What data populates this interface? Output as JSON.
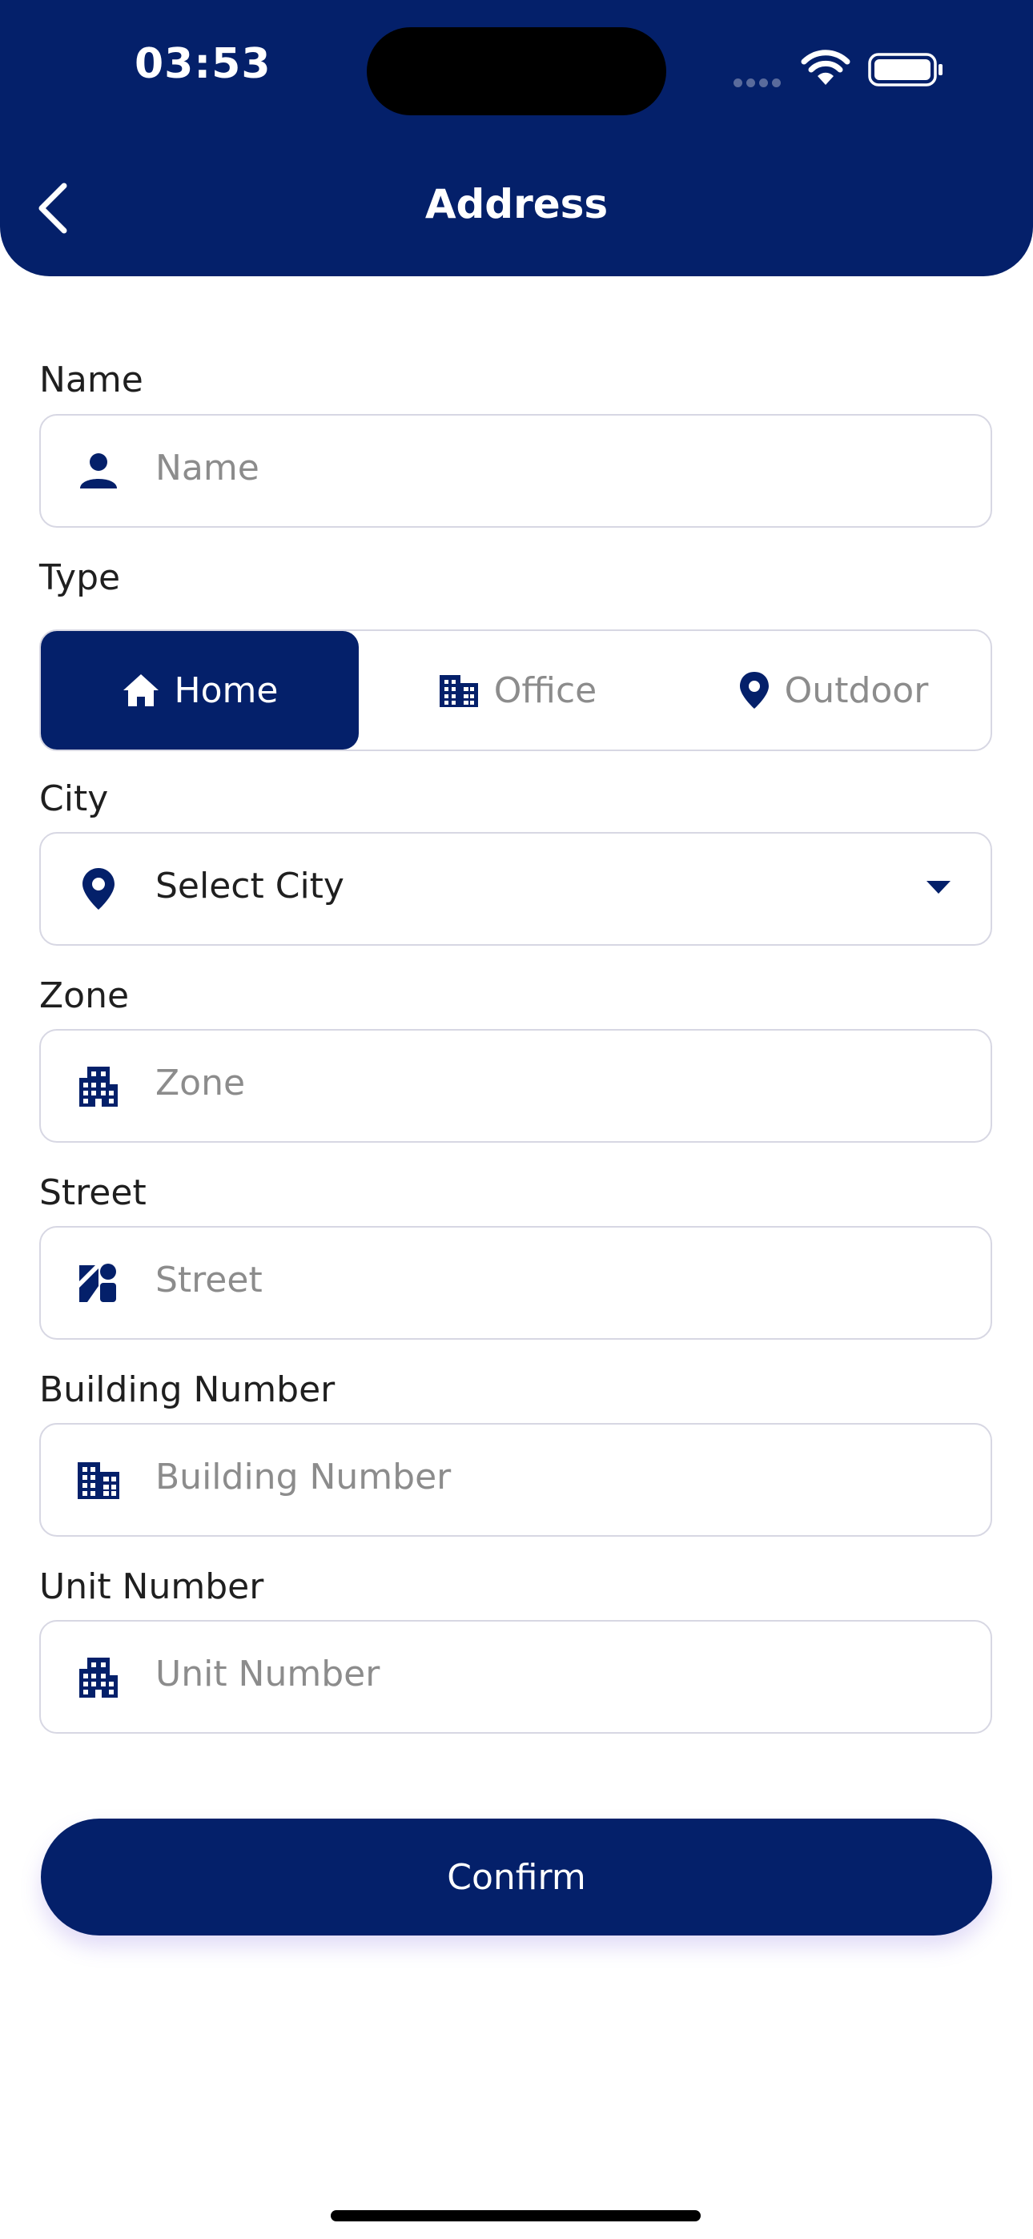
{
  "status_bar": {
    "time": "03:53"
  },
  "header": {
    "title": "Address"
  },
  "form": {
    "name": {
      "label": "Name",
      "placeholder": "Name"
    },
    "type": {
      "label": "Type",
      "options": [
        {
          "label": "Home",
          "icon": "home-icon",
          "selected": true
        },
        {
          "label": "Office",
          "icon": "office-building-icon",
          "selected": false
        },
        {
          "label": "Outdoor",
          "icon": "location-pin-icon",
          "selected": false
        }
      ]
    },
    "city": {
      "label": "City",
      "value": "Select City"
    },
    "zone": {
      "label": "Zone",
      "placeholder": "Zone"
    },
    "street": {
      "label": "Street",
      "placeholder": "Street"
    },
    "building": {
      "label": "Building Number",
      "placeholder": "Building Number"
    },
    "unit": {
      "label": "Unit Number",
      "placeholder": "Unit Number"
    }
  },
  "confirm_label": "Confirm",
  "colors": {
    "primary": "#04206a",
    "border": "#d7d7e3",
    "placeholder": "#8c8c8c"
  }
}
